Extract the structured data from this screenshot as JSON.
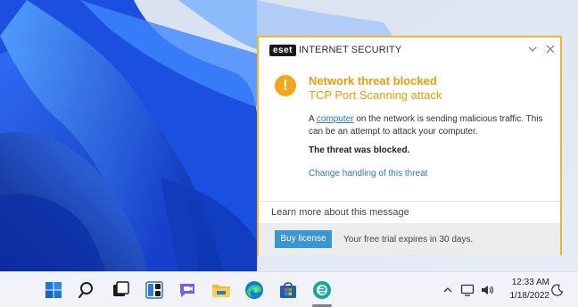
{
  "notification": {
    "logo_text": "eset",
    "product_name": "INTERNET SECURITY",
    "title": "Network threat blocked",
    "subtitle": "TCP Port Scanning attack",
    "message_prefix": "A ",
    "message_link": "computer",
    "message_suffix": " on the network is sending malicious traffic. This can be an attempt to attack your computer.",
    "blocked_text": "The threat was blocked.",
    "change_link": "Change handling of this threat",
    "learn_more": "Learn more about this message",
    "buy_button": "Buy license",
    "trial_text": "Your free trial expires in 30 days.",
    "icons": [
      "chevron-down-icon",
      "close-icon",
      "warning-icon"
    ],
    "colors": {
      "accent": "#f3b52b",
      "title": "#ef9b06",
      "link": "#2a7ab8",
      "button": "#3a96d3"
    }
  },
  "taskbar": {
    "apps": [
      "start-icon",
      "search-icon",
      "task-view-icon",
      "widgets-icon",
      "chat-icon",
      "file-explorer-icon",
      "edge-icon",
      "store-icon",
      "eset-icon"
    ],
    "tray_icons": [
      "chevron-up-icon",
      "network-icon",
      "volume-icon",
      "moon-icon"
    ],
    "time": "12:33 AM",
    "date": "1/18/2022"
  }
}
